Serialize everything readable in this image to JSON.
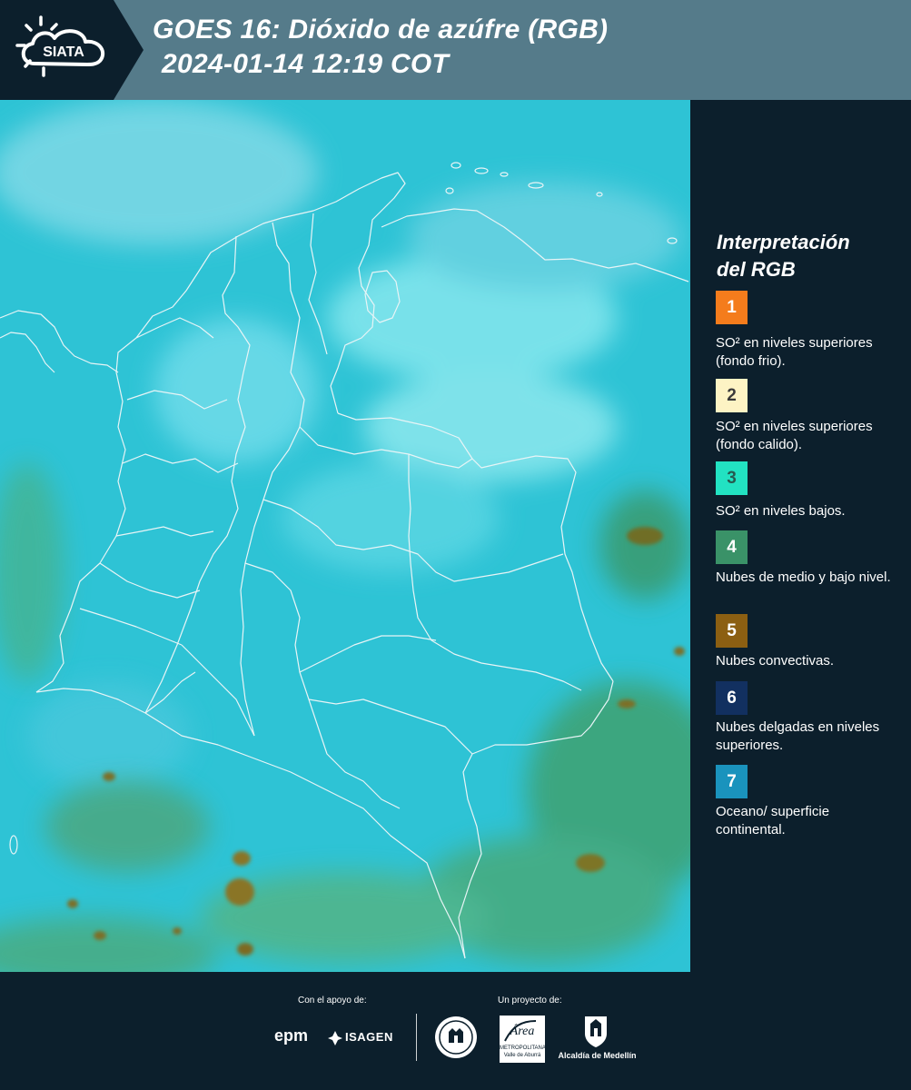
{
  "header": {
    "logo_text": "SIATA",
    "title_line1": "GOES 16: Dióxido de azúfre (RGB)",
    "title_line2": "2024-01-14 12:19 COT"
  },
  "legend": {
    "title_line1": "Interpretación",
    "title_line2": "del RGB",
    "items": [
      {
        "number": "1",
        "label": "SO² en niveles superiores (fondo frio).",
        "color": "#f47c1c",
        "text_color": "#ffffff"
      },
      {
        "number": "2",
        "label": "SO² en niveles superiores (fondo calido).",
        "color": "#fdf3c4",
        "text_color": "#3a3a3a"
      },
      {
        "number": "3",
        "label": "SO² en niveles bajos.",
        "color": "#22e2c2",
        "text_color": "#27594f"
      },
      {
        "number": "4",
        "label": "Nubes de medio y bajo nivel.",
        "color": "#3a9268",
        "text_color": "#ffffff"
      },
      {
        "number": "5",
        "label": "Nubes convectivas.",
        "color": "#8c5f12",
        "text_color": "#ffffff"
      },
      {
        "number": "6",
        "label": "Nubes delgadas en niveles superiores.",
        "color": "#123060",
        "text_color": "#ffffff"
      },
      {
        "number": "7",
        "label": "Oceano/ superficie continental.",
        "color": "#1a93bd",
        "text_color": "#ffffff"
      }
    ]
  },
  "footer": {
    "support_caption": "Con el apoyo de:",
    "project_caption": "Un proyecto de:",
    "logo_epm": "epm",
    "logo_isagen": "ISAGEN",
    "logo_area_main": "Área",
    "logo_area_sub1": "METROPOLITANA",
    "logo_area_sub2": "Valle de Aburrá",
    "logo_alcaldia": "Alcaldía de Medellín"
  },
  "map": {
    "ocean_color": "#2fc4d6",
    "border_color": "#e8f4f6",
    "convective_color": "#8a7426",
    "midlevel_cloud_color": "#3f9f6a"
  }
}
